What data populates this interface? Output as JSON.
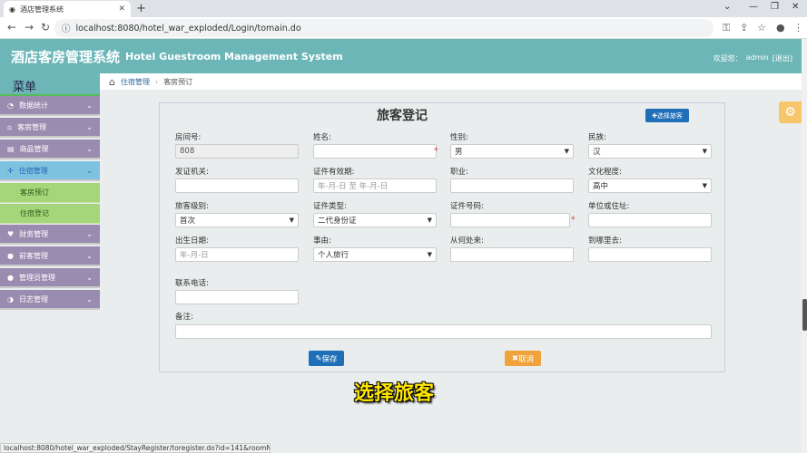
{
  "browser": {
    "tab_title": "酒店管理系统",
    "url": "localhost:8080/hotel_war_exploded/Login/tomain.do",
    "status_url": "localhost:8080/hotel_war_exploded/StayRegister/toregister.do?id=141&roomNumbe..."
  },
  "header": {
    "title_cn": "酒店客房管理系统",
    "title_en": "Hotel Guestroom Management System",
    "welcome": "欢迎您：",
    "user": "admin",
    "logout": "[退出]"
  },
  "sidebar": {
    "title": "菜单",
    "items": [
      {
        "label": "数据统计",
        "icon": "dashboard-icon"
      },
      {
        "label": "客房管理",
        "icon": "home-icon"
      },
      {
        "label": "商品管理",
        "icon": "goods-icon"
      },
      {
        "label": "住宿管理",
        "icon": "move-icon"
      },
      {
        "label": "财务管理",
        "icon": "heart-icon"
      },
      {
        "label": "前客管理",
        "icon": "user-icon"
      },
      {
        "label": "管理员管理",
        "icon": "user-icon"
      },
      {
        "label": "日志管理",
        "icon": "log-icon"
      }
    ],
    "subitems": [
      "客房预订",
      "住宿登记"
    ]
  },
  "breadcrumb": {
    "level1": "住宿管理",
    "level2": "客房预订"
  },
  "form": {
    "title": "旅客登记",
    "pick_button": "✚选择旅客",
    "labels": {
      "room_no": "房间号:",
      "name": "姓名:",
      "gender": "性别:",
      "ethnicity": "民族:",
      "issuer": "发证机关:",
      "id_valid": "证件有效期:",
      "job": "职业:",
      "education": "文化程度:",
      "guest_level": "旅客级别:",
      "id_type": "证件类型:",
      "id_no": "证件号码:",
      "unit": "单位或住址:",
      "birth": "出生日期:",
      "reason": "事由:",
      "from": "从何处来:",
      "to": "到哪里去:",
      "phone": "联系电话:",
      "remark": "备注:"
    },
    "values": {
      "room_no": "808",
      "gender": "男",
      "ethnicity": "汉",
      "education": "高中",
      "guest_level": "首次",
      "id_type": "二代身份证",
      "reason": "个人旅行"
    },
    "placeholders": {
      "id_valid": "年-月-日 至 年-月-日",
      "birth": "年-月-日"
    },
    "save": "保存",
    "cancel": "取消"
  },
  "caption": "选择旅客",
  "colors": {
    "header": "#6cb6b8",
    "menu_item": "#9a8bb0",
    "submenu": "#a6d67a",
    "primary": "#1f6fb8",
    "warning": "#f0a33a"
  }
}
